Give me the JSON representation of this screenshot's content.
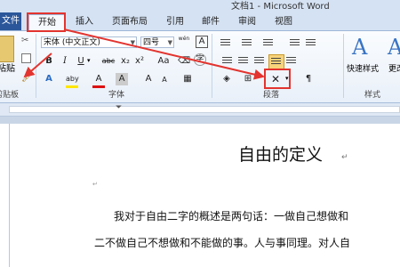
{
  "window": {
    "title": "文档1 - Microsoft Word"
  },
  "tabs": {
    "file": "文件",
    "home": "开始",
    "insert": "插入",
    "layout": "页面布局",
    "references": "引用",
    "mailings": "邮件",
    "review": "审阅",
    "view": "视图"
  },
  "ribbon": {
    "clipboard": {
      "paste_label": "粘贴",
      "group_label": "剪贴板"
    },
    "font": {
      "family_value": "宋体 (中文正文)",
      "size_value": "四号",
      "wen_label": "wén",
      "group_label": "字体",
      "strikethrough": "abc",
      "subscript": "x₂",
      "superscript": "x²",
      "case": "Aa",
      "highlight": "aby",
      "char_border": "A",
      "font_color": "A",
      "grow": "A",
      "shrink": "A",
      "char_shading": "A",
      "circled": "字"
    },
    "paragraph": {
      "group_label": "段落"
    },
    "styles": {
      "quick_styles_label": "快速样式",
      "change_styles_label": "更改",
      "group_label": "样式"
    }
  },
  "document": {
    "title": "自由的定义",
    "paragraph1": "我对于自由二字的概述是两句话：一做自己想做和",
    "paragraph2": "二不做自己不想做和不能做的事。人与事同理。对人自"
  },
  "annotation_color": "#e3342f"
}
